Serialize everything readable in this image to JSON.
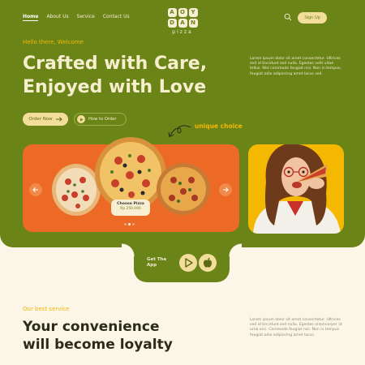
{
  "nav": {
    "items": [
      "Home",
      "About Us",
      "Service",
      "Contact Us"
    ],
    "signup_label": "Sign Up"
  },
  "logo": {
    "letters_row1": [
      "A",
      "O",
      "Y"
    ],
    "letters_row2": [
      "D",
      "A",
      "N"
    ],
    "subtitle": "pizza"
  },
  "hero": {
    "hello": "Hello there, Welcome",
    "headline_line1": "Crafted with Care,",
    "headline_line2": "Enjoyed with Love",
    "description": "Lorem ipsum dolor sit amet consectetur. Ultrices sed id tincidunt sed nulla. Egestas velit vitae tellus. Nisl commodo feugiat nisi. Non in tempus, feugiat odio adipiscing amet lacus sed.",
    "order_now_label": "Order Now",
    "how_to_order_label": "How to Order",
    "unique_choice": "unique choice"
  },
  "carousel": {
    "choose_title": "Choose Pizza",
    "choose_price": "Rp 250.000",
    "active_index": 1,
    "dot_count": 3
  },
  "app": {
    "label_line1": "Get The",
    "label_line2": "App",
    "icons": [
      "play-store-icon",
      "apple-icon"
    ]
  },
  "service": {
    "eyebrow": "Our best service",
    "headline_line1": "Your convenience",
    "headline_line2": "will become loyalty",
    "description": "Lorem ipsum dolor sit amet consectetur. Ultrices sed id tincidunt sed nulla. Egestas ullamcorper id urna orci. Commodo feugiat nisi. Non in tempus feugiat odio adipiscing amet lacus."
  },
  "colors": {
    "olive": "#6b8418",
    "cream": "#fcf6e8",
    "orange": "#ec6a25",
    "yellow": "#f5b800",
    "button": "#f3dd9a"
  }
}
